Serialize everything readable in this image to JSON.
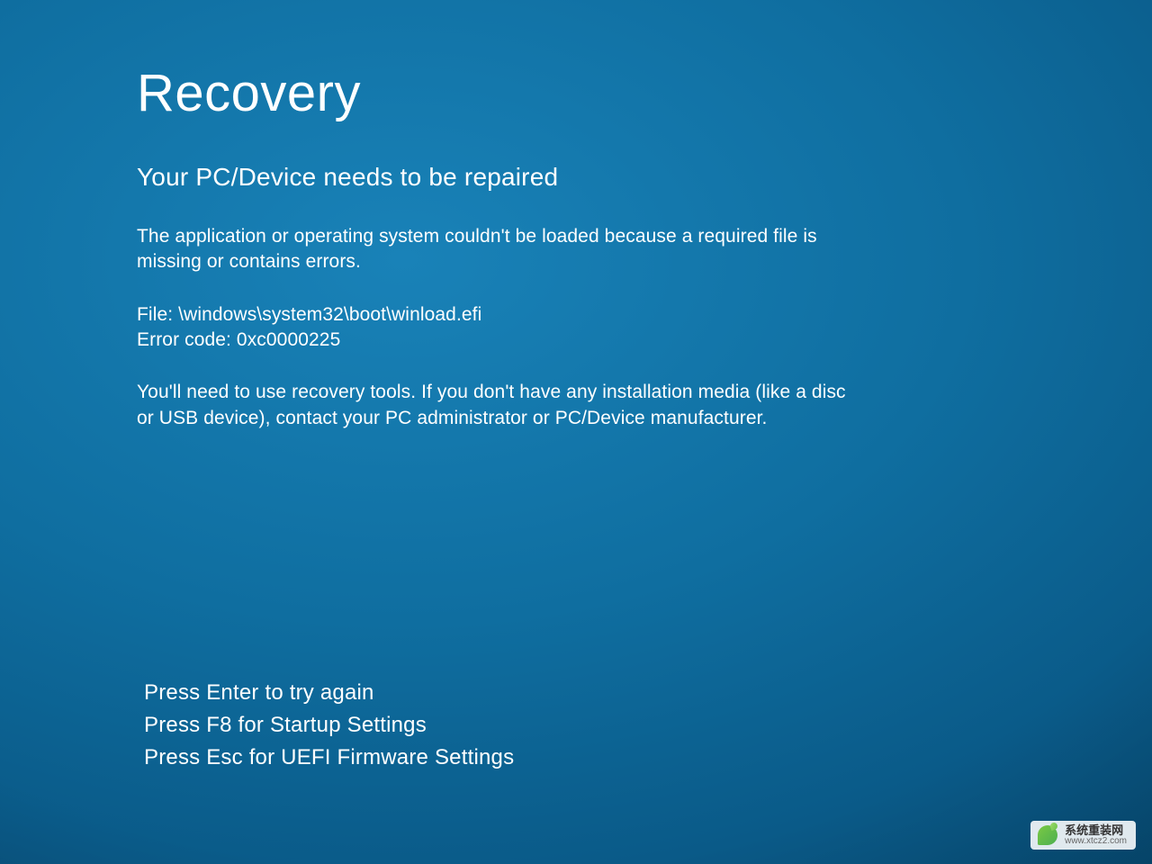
{
  "recovery": {
    "title": "Recovery",
    "subtitle": "Your PC/Device needs to be repaired",
    "message": "The application or operating system couldn't be loaded because a required file is missing or contains errors.",
    "file_label": "File:",
    "file_path": "\\windows\\system32\\boot\\winload.efi",
    "error_label": "Error code:",
    "error_code": "0xc0000225",
    "advice": "You'll need to use recovery tools. If you don't have any installation media (like a disc or USB device), contact your PC administrator or PC/Device manufacturer."
  },
  "keys": {
    "enter": "Press Enter to try again",
    "f8": "Press F8 for Startup Settings",
    "esc": "Press Esc for UEFI Firmware Settings"
  },
  "watermark": {
    "cn": "系统重装网",
    "url": "www.xtcz2.com"
  }
}
